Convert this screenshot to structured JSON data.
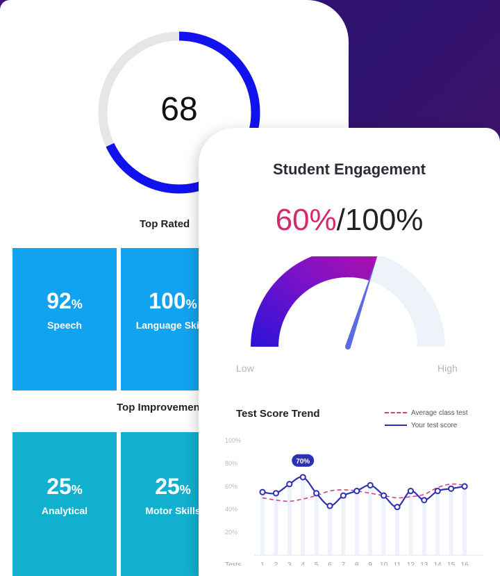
{
  "overall": {
    "score": "68",
    "progress": 0.68
  },
  "top_rated": {
    "title": "Top Rated",
    "tiles": [
      {
        "value": "92",
        "unit": "%",
        "label": "Speech"
      },
      {
        "value": "100",
        "unit": "%",
        "label": "Language Skills"
      }
    ]
  },
  "top_improvement": {
    "title": "Top Improvement",
    "tiles": [
      {
        "value": "25",
        "unit": "%",
        "label": "Analytical"
      },
      {
        "value": "25",
        "unit": "%",
        "label": "Motor Skills"
      }
    ]
  },
  "engagement": {
    "title": "Student Engagement",
    "value": "60%",
    "total": "/100%",
    "level": 0.6,
    "low_label": "Low",
    "high_label": "High"
  },
  "chart_data": {
    "type": "line",
    "title": "Test Score Trend",
    "xlabel": "Tests",
    "ylabel": "",
    "x": [
      1,
      2,
      3,
      4,
      5,
      6,
      7,
      8,
      9,
      10,
      11,
      12,
      13,
      14,
      15,
      16
    ],
    "yticks": [
      "20%",
      "40%",
      "60%",
      "80%",
      "100%"
    ],
    "ylim": [
      0,
      100
    ],
    "series": [
      {
        "name": "Average class test",
        "style": "dashed",
        "color": "#d63b8d",
        "values": [
          50,
          48,
          47,
          49,
          52,
          56,
          57,
          56,
          54,
          52,
          50,
          51,
          53,
          59,
          62,
          61
        ]
      },
      {
        "name": "Your test score",
        "style": "solid",
        "color": "#2d2fb5",
        "values": [
          55,
          54,
          62,
          68,
          54,
          43,
          52,
          56,
          61,
          52,
          42,
          56,
          48,
          56,
          58,
          60
        ]
      }
    ],
    "callout": {
      "x": 4,
      "label": "70%"
    },
    "grid": false,
    "legend_position": "top-right"
  },
  "colors": {
    "ring_progress": "#1212ee",
    "ring_track": "#e6e6e6",
    "tile_blue": "#12a3f0",
    "tile_teal": "#12b0cf",
    "engagement_value": "#d42a6a"
  }
}
